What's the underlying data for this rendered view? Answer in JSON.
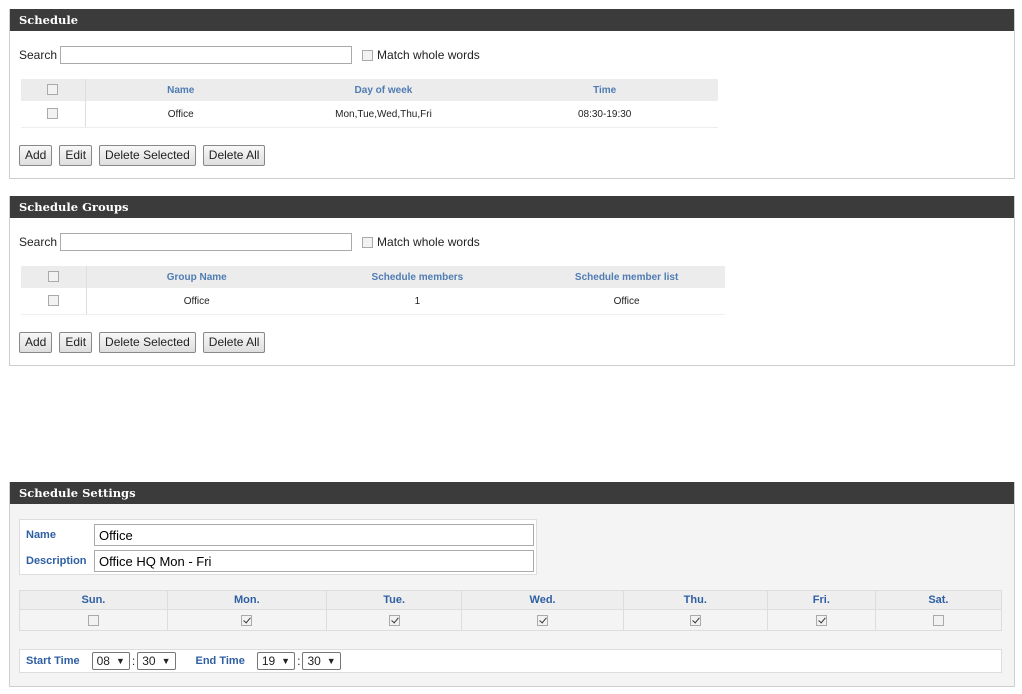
{
  "schedule": {
    "title": "Schedule",
    "search_label": "Search",
    "search_value": "",
    "match_label": "Match whole words",
    "columns": [
      "Name",
      "Day of week",
      "Time"
    ],
    "rows": [
      {
        "name": "Office",
        "days": "Mon,Tue,Wed,Thu,Fri",
        "time": "08:30-19:30"
      }
    ],
    "buttons": {
      "add": "Add",
      "edit": "Edit",
      "delete_selected": "Delete Selected",
      "delete_all": "Delete All"
    }
  },
  "groups": {
    "title": "Schedule Groups",
    "search_label": "Search",
    "search_value": "",
    "match_label": "Match whole words",
    "columns": [
      "Group Name",
      "Schedule members",
      "Schedule member list"
    ],
    "rows": [
      {
        "group": "Office",
        "members": "1",
        "list": "Office"
      }
    ],
    "buttons": {
      "add": "Add",
      "edit": "Edit",
      "delete_selected": "Delete Selected",
      "delete_all": "Delete All"
    }
  },
  "settings": {
    "title": "Schedule Settings",
    "name_label": "Name",
    "name_value": "Office",
    "desc_label": "Description",
    "desc_value": "Office HQ Mon - Fri",
    "days": [
      {
        "label": "Sun.",
        "checked": false
      },
      {
        "label": "Mon.",
        "checked": true
      },
      {
        "label": "Tue.",
        "checked": true
      },
      {
        "label": "Wed.",
        "checked": true
      },
      {
        "label": "Thu.",
        "checked": true
      },
      {
        "label": "Fri.",
        "checked": true
      },
      {
        "label": "Sat.",
        "checked": false
      }
    ],
    "start_label": "Start Time",
    "start_hour": "08",
    "start_min": "30",
    "end_label": "End Time",
    "end_hour": "19",
    "end_min": "30",
    "colon": ":"
  },
  "colors": {
    "header_bg": "#3b3b3b",
    "label_blue": "#2e5fa3",
    "column_blue": "#4f7cb3"
  }
}
